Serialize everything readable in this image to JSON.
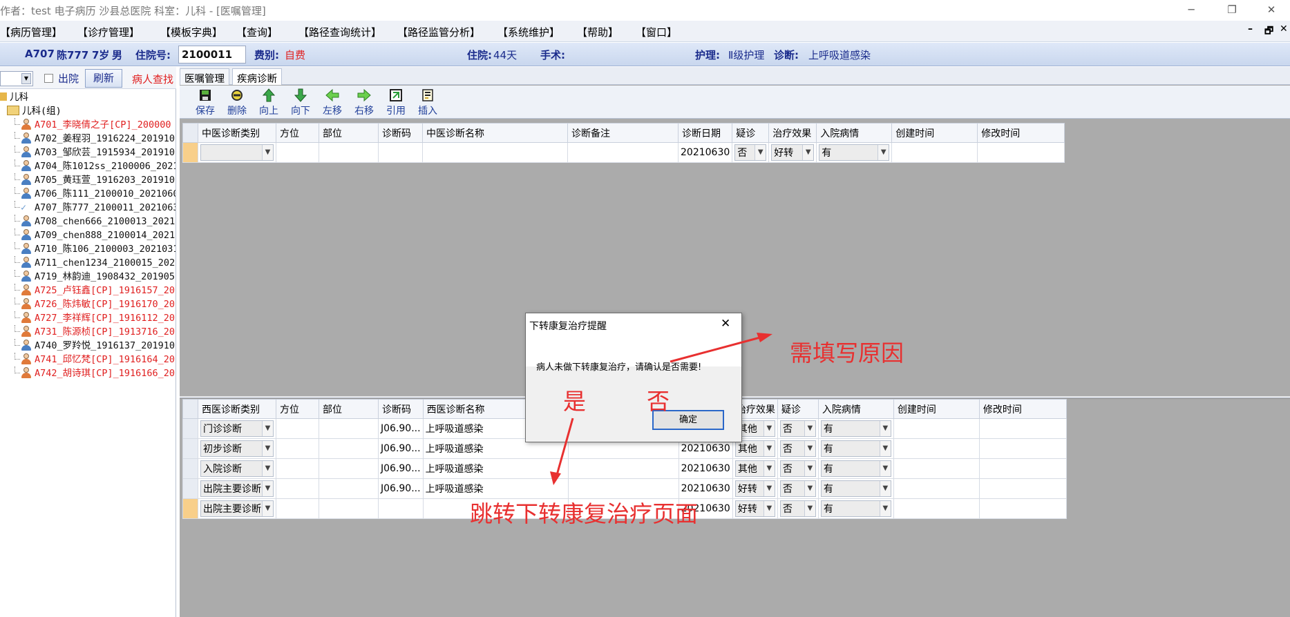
{
  "window": {
    "title": "作者：test 电子病历  沙县总医院  科室：儿科 - [医嘱管理]",
    "min": "─",
    "max": "❐",
    "close": "✕"
  },
  "menu": [
    "【病历管理】",
    "【诊疗管理】",
    "【模板字典】",
    "【查询】",
    "【路径查询统计】",
    "【路径监管分析】",
    "【系统维护】",
    "【帮助】",
    "【窗口】"
  ],
  "mdi_controls": [
    "–",
    "🗗",
    "✕"
  ],
  "patient": {
    "bed": "A707",
    "name": "陈777",
    "age": "7岁",
    "sex": "男",
    "admit_label": "住院号:",
    "admit_no": "2100011",
    "fee_label": "费别:",
    "fee": "自费",
    "stay_label": "住院:",
    "stay": "44天",
    "surgery_label": "手术:",
    "nursing_label": "护理:",
    "nursing": "Ⅱ级护理",
    "diag_label": "诊断:",
    "diagnosis": "上呼吸道感染"
  },
  "left": {
    "discharged_label": "出院",
    "refresh": "刷新",
    "search": "病人查找",
    "dept": "儿科",
    "group": "儿科(组)",
    "patients": [
      {
        "text": "A701_李晓倩之子[CP]_200000",
        "red": true
      },
      {
        "text": "A702_姜程羽_1916224_201910",
        "red": false
      },
      {
        "text": "A703_邹欣芸_1915934_201910",
        "red": false
      },
      {
        "text": "A704_陈1012ss_2100006_2021",
        "red": false
      },
      {
        "text": "A705_黄珏萱_1916203_201910",
        "red": false
      },
      {
        "text": "A706_陈111_2100010_2021060",
        "red": false
      },
      {
        "text": "A707_陈777_2100011_2021063",
        "red": false,
        "checked": true
      },
      {
        "text": "A708_chen666_2100013_20210",
        "red": false
      },
      {
        "text": "A709_chen888_2100014_20210",
        "red": false
      },
      {
        "text": "A710_陈106_2100003_2021031",
        "red": false
      },
      {
        "text": "A711_chen1234_2100015_2021",
        "red": false
      },
      {
        "text": "A719_林韵迪_1908432_201905",
        "red": false
      },
      {
        "text": "A725_卢钰鑫[CP]_1916157_20",
        "red": true
      },
      {
        "text": "A726_陈炜敏[CP]_1916170_20",
        "red": true
      },
      {
        "text": "A727_李祥辉[CP]_1916112_20",
        "red": true
      },
      {
        "text": "A731_陈源桢[CP]_1913716_20",
        "red": true
      },
      {
        "text": "A740_罗羚悦_1916137_201910",
        "red": false
      },
      {
        "text": "A741_邱忆梵[CP]_1916164_20",
        "red": true
      },
      {
        "text": "A742_胡诗琪[CP]_1916166_20",
        "red": true
      }
    ]
  },
  "tabs": [
    "医嘱管理",
    "疾病诊断"
  ],
  "toolbar": [
    "保存",
    "删除",
    "向上",
    "向下",
    "左移",
    "右移",
    "引用",
    "插入"
  ],
  "tcm_grid": {
    "headers": [
      "中医诊断类别",
      "方位",
      "部位",
      "诊断码",
      "中医诊断名称",
      "诊断备注",
      "诊断日期",
      "疑诊",
      "治疗效果",
      "入院病情",
      "创建时间",
      "修改时间"
    ],
    "rows": [
      {
        "category": "",
        "side": "",
        "part": "",
        "code": "",
        "name": "",
        "note": "",
        "date": "20210630",
        "suspect": "否",
        "effect": "好转",
        "admission": "有",
        "created": "",
        "modified": ""
      }
    ]
  },
  "wm_grid": {
    "headers": [
      "西医诊断类别",
      "方位",
      "部位",
      "诊断码",
      "西医诊断名称",
      "诊断备注",
      "诊断日期",
      "治疗效果",
      "疑诊",
      "入院病情",
      "创建时间",
      "修改时间"
    ],
    "rows": [
      {
        "category": "门诊诊断",
        "code": "J06.90...",
        "name": "上呼吸道感染",
        "date": "20210630",
        "effect": "其他",
        "suspect": "否",
        "admission": "有"
      },
      {
        "category": "初步诊断",
        "code": "J06.90...",
        "name": "上呼吸道感染",
        "date": "20210630",
        "effect": "其他",
        "suspect": "否",
        "admission": "有"
      },
      {
        "category": "入院诊断",
        "code": "J06.90...",
        "name": "上呼吸道感染",
        "date": "20210630",
        "effect": "其他",
        "suspect": "否",
        "admission": "有"
      },
      {
        "category": "出院主要诊断",
        "code": "J06.90...",
        "name": "上呼吸道感染",
        "date": "20210630",
        "effect": "好转",
        "suspect": "否",
        "admission": "有"
      },
      {
        "category": "出院主要诊断",
        "code": "",
        "name": "",
        "date": "20210630",
        "effect": "好转",
        "suspect": "否",
        "admission": "有"
      }
    ]
  },
  "dialog": {
    "title": "下转康复治疗提醒",
    "message": "病人未做下转康复治疗，请确认是否需要!",
    "ok": "确定",
    "close": "✕"
  },
  "annotations": {
    "reason": "需填写原因",
    "yes": "是",
    "no": "否",
    "jump": "跳转下转康复治疗页面",
    "color": "#e83030"
  }
}
